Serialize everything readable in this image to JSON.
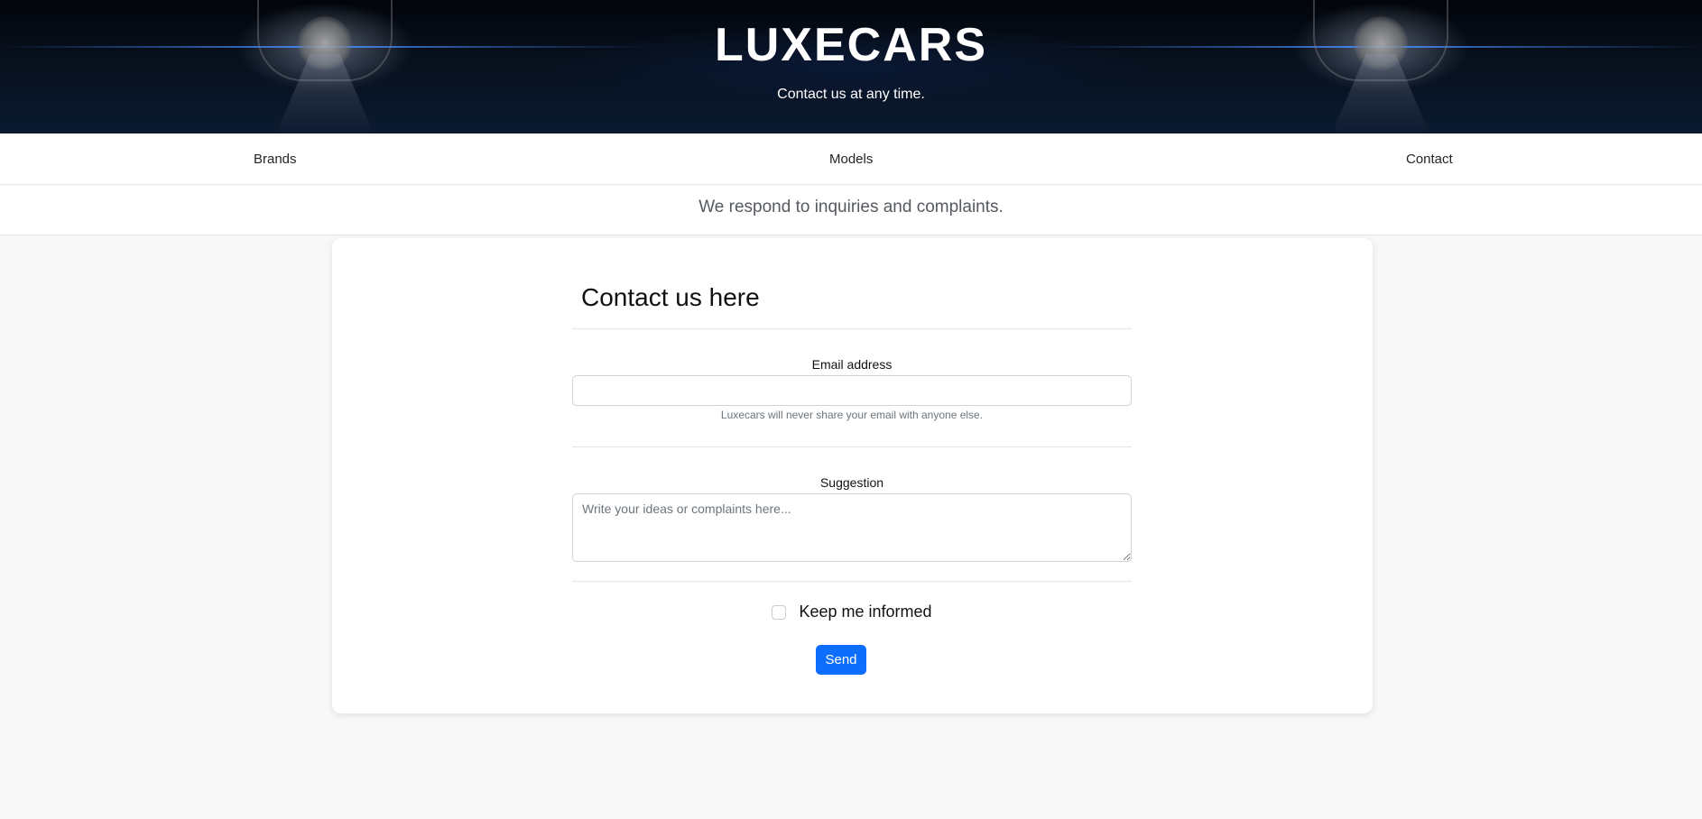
{
  "header": {
    "brand": "LUXECARS",
    "subtitle": "Contact us at any time."
  },
  "nav": {
    "items": [
      {
        "label": "Brands"
      },
      {
        "label": "Models"
      },
      {
        "label": "Contact"
      }
    ]
  },
  "tagline": "We respond to inquiries and complaints.",
  "form": {
    "title": "Contact us here",
    "email": {
      "label": "Email address",
      "value": "",
      "help": "Luxecars will never share your email with anyone else."
    },
    "suggestion": {
      "label": "Suggestion",
      "placeholder": "Write your ideas or complaints here..."
    },
    "keep_informed": {
      "label": "Keep me informed",
      "checked": false
    },
    "submit_label": "Send"
  },
  "colors": {
    "primary": "#0d6efd",
    "page_bg": "#f8f8f8",
    "hero_bg": "#07101d"
  }
}
